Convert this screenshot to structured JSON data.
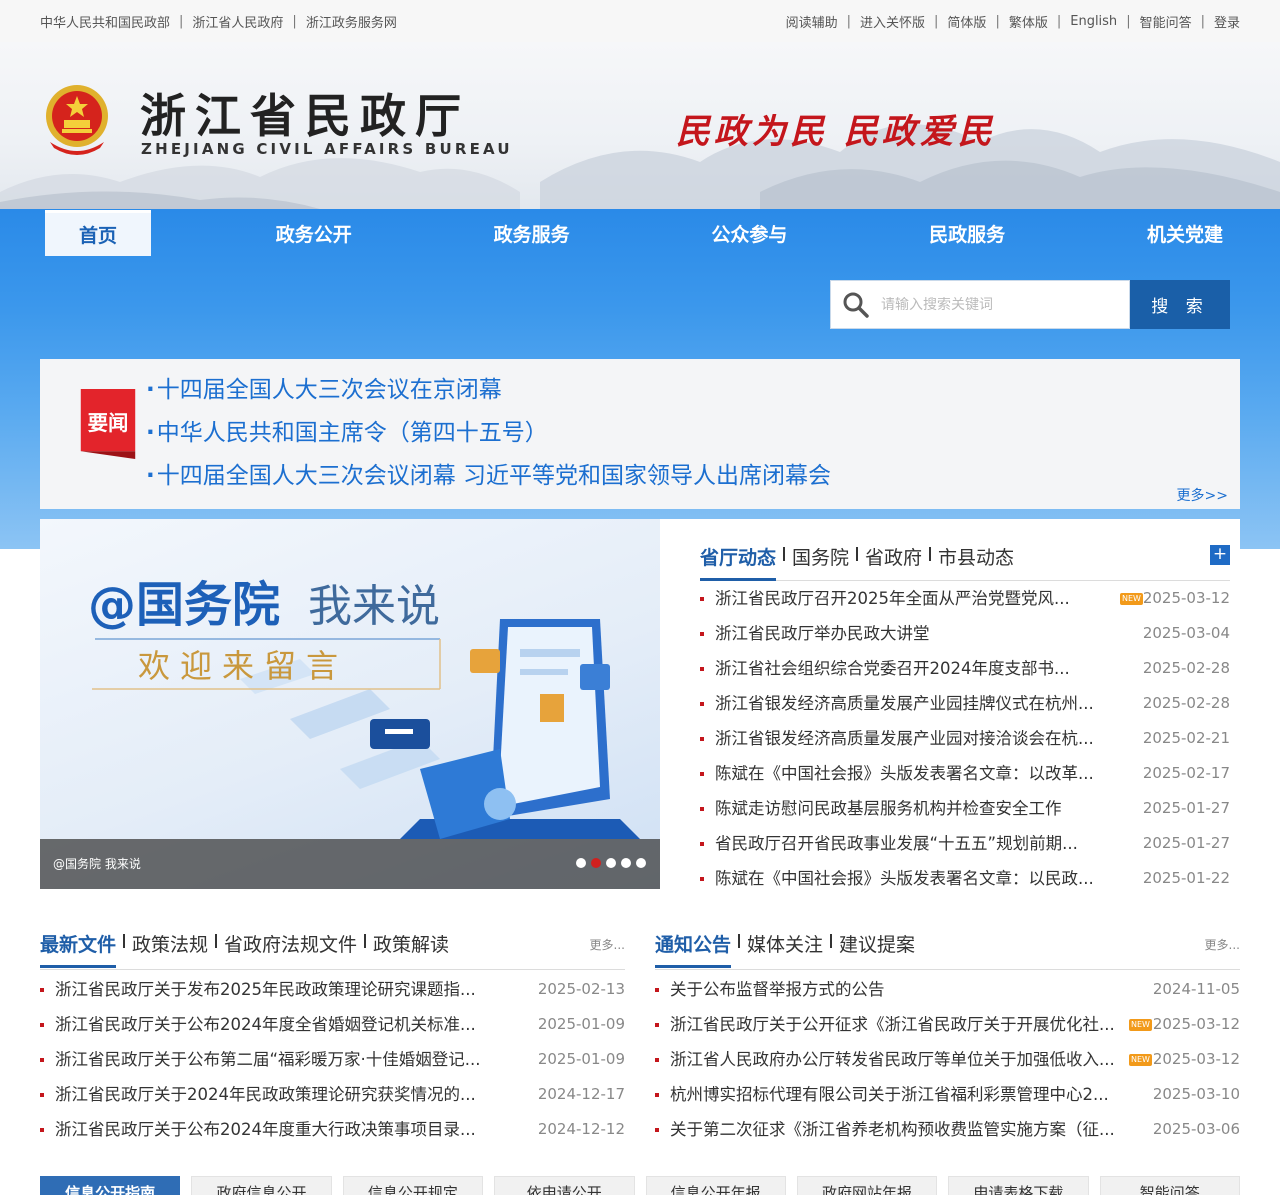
{
  "topbar": {
    "left_links": [
      "中华人民共和国民政部",
      "浙江省人民政府",
      "浙江政务服务网"
    ],
    "right_links": [
      "阅读辅助",
      "进入关怀版",
      "简体版",
      "繁体版",
      "English",
      "智能问答",
      "登录"
    ]
  },
  "header": {
    "title_cn": "浙江省民政厅",
    "title_en": "ZHEJIANG CIVIL AFFAIRS BUREAU",
    "slogan": "民政为民 民政爱民"
  },
  "nav": {
    "items": [
      "首页",
      "政务公开",
      "政务服务",
      "公众参与",
      "民政服务",
      "机关党建"
    ],
    "active": 0
  },
  "search": {
    "placeholder": "请输入搜索关键词",
    "button": "搜 索"
  },
  "headline": {
    "badge": "要闻",
    "items": [
      "十四届全国人大三次会议在京闭幕",
      "中华人民共和国主席令（第四十五号）",
      "十四届全国人大三次会议闭幕 习近平等党和国家领导人出席闭幕会"
    ],
    "more": "更多>>"
  },
  "slider": {
    "banner_line1a": "@国务院",
    "banner_line1b": "我来说",
    "banner_line2": "欢迎来留言",
    "caption": "@国务院 我来说",
    "dot_count": 5,
    "active_dot": 1
  },
  "news": {
    "tabs": [
      "省厅动态",
      "国务院",
      "省政府",
      "市县动态"
    ],
    "plus": "+",
    "items": [
      {
        "title": "浙江省民政厅召开2025年全面从严治党暨党风...",
        "date": "2025-03-12",
        "new": "NEW"
      },
      {
        "title": "浙江省民政厅举办民政大讲堂",
        "date": "2025-03-04"
      },
      {
        "title": "浙江省社会组织综合党委召开2024年度支部书...",
        "date": "2025-02-28"
      },
      {
        "title": "浙江省银发经济高质量发展产业园挂牌仪式在杭州...",
        "date": "2025-02-28"
      },
      {
        "title": "浙江省银发经济高质量发展产业园对接洽谈会在杭...",
        "date": "2025-02-21"
      },
      {
        "title": "陈斌在《中国社会报》头版发表署名文章：以改革...",
        "date": "2025-02-17"
      },
      {
        "title": "陈斌走访慰问民政基层服务机构并检查安全工作",
        "date": "2025-01-27"
      },
      {
        "title": "省民政厅召开省民政事业发展“十五五”规划前期...",
        "date": "2025-01-27"
      },
      {
        "title": "陈斌在《中国社会报》头版发表署名文章：以民政...",
        "date": "2025-01-22"
      }
    ]
  },
  "files": {
    "tabs": [
      "最新文件",
      "政策法规",
      "省政府法规文件",
      "政策解读"
    ],
    "more": "更多...",
    "items": [
      {
        "title": "浙江省民政厅关于发布2025年民政政策理论研究课题指...",
        "date": "2025-02-13"
      },
      {
        "title": "浙江省民政厅关于公布2024年度全省婚姻登记机关标准...",
        "date": "2025-01-09"
      },
      {
        "title": "浙江省民政厅关于公布第二届“福彩暖万家·十佳婚姻登记...",
        "date": "2025-01-09"
      },
      {
        "title": "浙江省民政厅关于2024年民政政策理论研究获奖情况的...",
        "date": "2024-12-17"
      },
      {
        "title": "浙江省民政厅关于公布2024年度重大行政决策事项目录...",
        "date": "2024-12-12"
      }
    ]
  },
  "notices": {
    "tabs": [
      "通知公告",
      "媒体关注",
      "建议提案"
    ],
    "more": "更多...",
    "items": [
      {
        "title": "关于公布监督举报方式的公告",
        "date": "2024-11-05"
      },
      {
        "title": "浙江省民政厅关于公开征求《浙江省民政厅关于开展优化社...",
        "date": "2025-03-12",
        "new": "NEW"
      },
      {
        "title": "浙江省人民政府办公厅转发省民政厅等单位关于加强低收入...",
        "date": "2025-03-12",
        "new": "NEW"
      },
      {
        "title": "杭州博实招标代理有限公司关于浙江省福利彩票管理中心2...",
        "date": "2025-03-10"
      },
      {
        "title": "关于第二次征求《浙江省养老机构预收费监管实施方案（征...",
        "date": "2025-03-06"
      }
    ]
  },
  "bottom_tabs": [
    "信息公开指南",
    "政府信息公开",
    "信息公开规定",
    "依申请公开",
    "信息公开年报",
    "政府网站年报",
    "申请表格下载",
    "智能问答"
  ],
  "colors": {
    "nav_blue": "#2a8ae8",
    "headline_blue": "#1c6fd0",
    "accent_red": "#c4161c",
    "dark_blue": "#1f5ea8"
  }
}
